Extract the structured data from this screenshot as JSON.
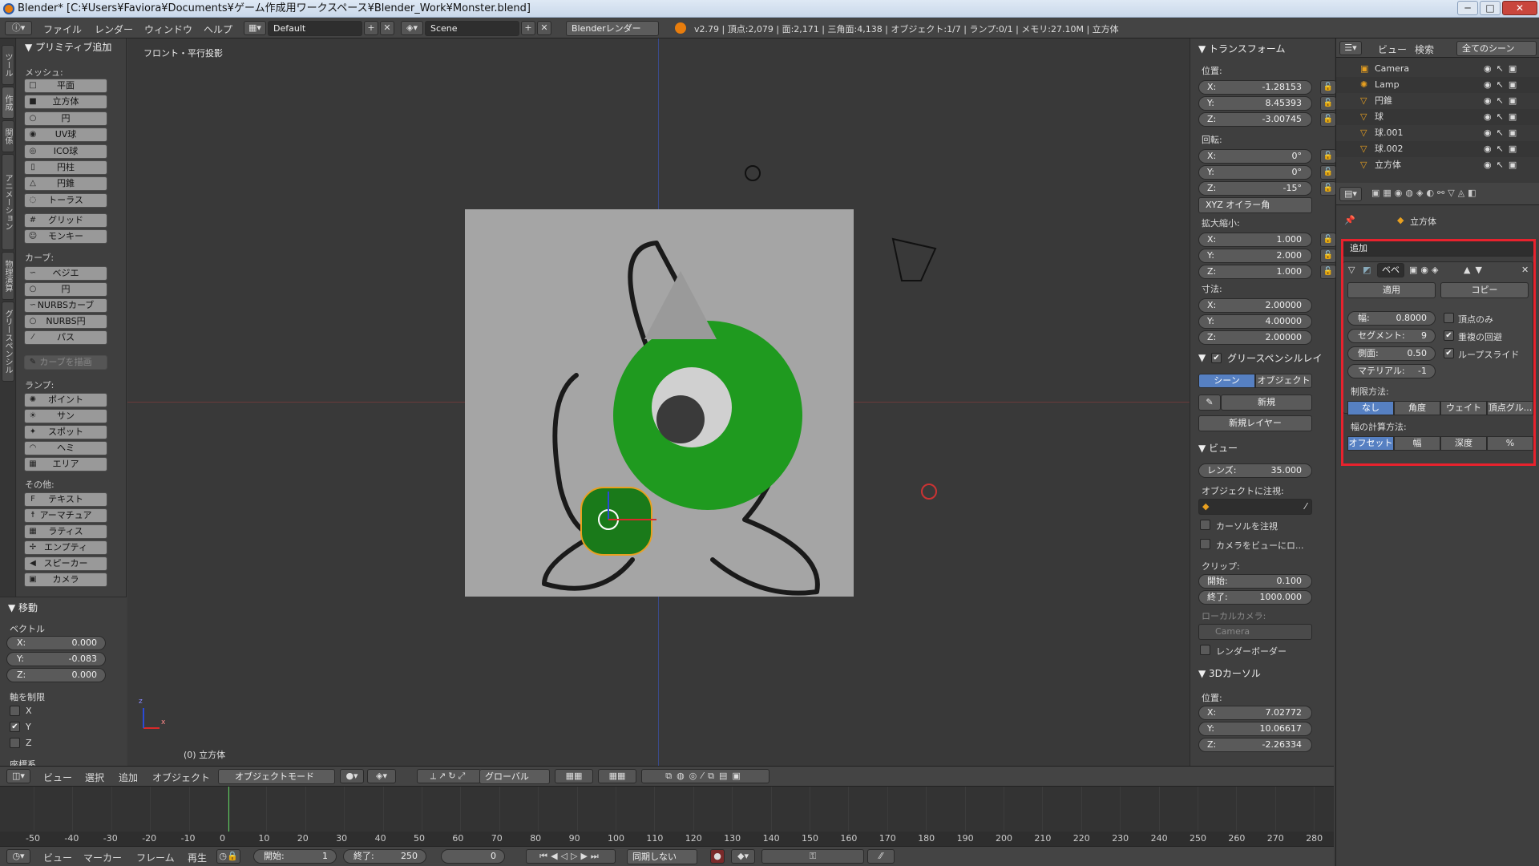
{
  "window": {
    "title": "Blender* [C:¥Users¥Faviora¥Documents¥ゲーム作成用ワークスペース¥Blender_Work¥Monster.blend]",
    "controls": [
      "─",
      "□",
      "✕"
    ]
  },
  "info_header": {
    "menus": [
      "ファイル",
      "レンダー",
      "ウィンドウ",
      "ヘルプ"
    ],
    "layout": "Default",
    "scene": "Scene",
    "engine": "Blenderレンダー",
    "stats": "v2.79 | 頂点:2,079 | 面:2,171 | 三角面:4,138 | オブジェクト:1/7 | ランプ:0/1 | メモリ:27.10M | 立方体"
  },
  "left_tabs": [
    "ツール",
    "作成",
    "関係",
    "アニメーション",
    "物理演算",
    "グリースペンシル"
  ],
  "toolshelf": {
    "header": "▼ プリミティブ追加",
    "mesh_label": "メッシュ:",
    "mesh": [
      {
        "label": "平面",
        "icon": "□"
      },
      {
        "label": "立方体",
        "icon": "■"
      },
      {
        "label": "円",
        "icon": "○"
      },
      {
        "label": "UV球",
        "icon": "◉"
      },
      {
        "label": "ICO球",
        "icon": "◎"
      },
      {
        "label": "円柱",
        "icon": "▯"
      },
      {
        "label": "円錐",
        "icon": "△"
      },
      {
        "label": "トーラス",
        "icon": "◌"
      }
    ],
    "mesh_extra": [
      {
        "label": "グリッド",
        "icon": "#"
      },
      {
        "label": "モンキー",
        "icon": "☺"
      }
    ],
    "curve_label": "カーブ:",
    "curves": [
      {
        "label": "ベジエ",
        "icon": "∽"
      },
      {
        "label": "円",
        "icon": "○"
      },
      {
        "label": "NURBSカーブ",
        "icon": "∽"
      },
      {
        "label": "NURBS円",
        "icon": "○"
      },
      {
        "label": "パス",
        "icon": "⁄"
      }
    ],
    "draw_curve": "カーブを描画",
    "lamp_label": "ランプ:",
    "lamps": [
      {
        "label": "ポイント",
        "icon": "✺"
      },
      {
        "label": "サン",
        "icon": "☀"
      },
      {
        "label": "スポット",
        "icon": "✦"
      },
      {
        "label": "ヘミ",
        "icon": "◠"
      },
      {
        "label": "エリア",
        "icon": "▦"
      }
    ],
    "other_label": "その他:",
    "others": [
      {
        "label": "テキスト",
        "icon": "F"
      },
      {
        "label": "アーマチュア",
        "icon": "☨"
      },
      {
        "label": "ラティス",
        "icon": "▦"
      },
      {
        "label": "エンプティ",
        "icon": "✢"
      },
      {
        "label": "スピーカー",
        "icon": "◀"
      },
      {
        "label": "カメラ",
        "icon": "▣"
      }
    ]
  },
  "operator_panel": {
    "header": "▼ 移動",
    "vector_label": "ベクトル",
    "vector": [
      {
        "axis": "X:",
        "value": "0.000"
      },
      {
        "axis": "Y:",
        "value": "-0.083"
      },
      {
        "axis": "Z:",
        "value": "0.000"
      }
    ],
    "constrain_label": "軸を制限",
    "axes": [
      {
        "label": "X",
        "checked": false
      },
      {
        "label": "Y",
        "checked": true
      },
      {
        "label": "Z",
        "checked": false
      }
    ],
    "coord_label": "座標系"
  },
  "viewport": {
    "view_name": "フロント・平行投影",
    "object_name": "(0) 立方体",
    "axis_z": "z",
    "axis_x": "x"
  },
  "npanel": {
    "transform_header": "▼ トランスフォーム",
    "location_label": "位置:",
    "location": [
      {
        "axis": "X:",
        "value": "-1.28153"
      },
      {
        "axis": "Y:",
        "value": "8.45393"
      },
      {
        "axis": "Z:",
        "value": "-3.00745"
      }
    ],
    "rotation_label": "回転:",
    "rotation": [
      {
        "axis": "X:",
        "value": "0°"
      },
      {
        "axis": "Y:",
        "value": "0°"
      },
      {
        "axis": "Z:",
        "value": "-15°"
      }
    ],
    "rotation_mode": "XYZ オイラー角",
    "scale_label": "拡大縮小:",
    "scale": [
      {
        "axis": "X:",
        "value": "1.000"
      },
      {
        "axis": "Y:",
        "value": "2.000"
      },
      {
        "axis": "Z:",
        "value": "1.000"
      }
    ],
    "dimensions_label": "寸法:",
    "dimensions": [
      {
        "axis": "X:",
        "value": "2.00000"
      },
      {
        "axis": "Y:",
        "value": "4.00000"
      },
      {
        "axis": "Z:",
        "value": "2.00000"
      }
    ],
    "gp_header": "グリースペンシルレイ",
    "gp_tabs": [
      "シーン",
      "オブジェクト"
    ],
    "gp_new": "新規",
    "gp_new_layer": "新規レイヤー",
    "view_header": "▼ ビュー",
    "lens_label": "レンズ:",
    "lens_value": "35.000",
    "lock_object_label": "オブジェクトに注視:",
    "lock_cursor": "カーソルを注視",
    "lock_camera": "カメラをビューにロ...",
    "clip_label": "クリップ:",
    "clip_start_label": "開始:",
    "clip_start": "0.100",
    "clip_end_label": "終了:",
    "clip_end": "1000.000",
    "local_camera_label": "ローカルカメラ:",
    "local_camera": "Camera",
    "render_border": "レンダーボーダー",
    "cursor_header": "▼ 3Dカーソル",
    "cursor_location_label": "位置:",
    "cursor": [
      {
        "axis": "X:",
        "value": "7.02772"
      },
      {
        "axis": "Y:",
        "value": "10.06617"
      },
      {
        "axis": "Z:",
        "value": "-2.26334"
      }
    ]
  },
  "outliner": {
    "menus": [
      "ビュー",
      "検索"
    ],
    "filter": "全てのシーン",
    "items": [
      "Camera",
      "Lamp",
      "円錐",
      "球",
      "球.001",
      "球.002",
      "立方体"
    ]
  },
  "properties": {
    "object_name": "立方体",
    "add_modifier": "追加",
    "modifier_name": "ベベ",
    "apply": "適用",
    "copy": "コピー",
    "width_label": "幅:",
    "width_value": "0.8000",
    "segments_label": "セグメント:",
    "segments_value": "9",
    "profile_label": "側面:",
    "profile_value": "0.50",
    "material_label": "マテリアル:",
    "material_value": "-1",
    "vertex_only": "頂点のみ",
    "clamp_overlap": "重複の回避",
    "loop_slide": "ループスライド",
    "limit_label": "制限方法:",
    "limit_options": [
      "なし",
      "角度",
      "ウェイト",
      "頂点グル..."
    ],
    "width_method_label": "幅の計算方法:",
    "width_methods": [
      "オフセット",
      "幅",
      "深度",
      "%"
    ]
  },
  "view3d_header": {
    "menus": [
      "ビュー",
      "選択",
      "追加",
      "オブジェクト"
    ],
    "mode": "オブジェクトモード",
    "orientation": "グローバル"
  },
  "timeline": {
    "ticks": [
      "-50",
      "-40",
      "-30",
      "-20",
      "-10",
      "0",
      "10",
      "20",
      "30",
      "40",
      "50",
      "60",
      "70",
      "80",
      "90",
      "100",
      "110",
      "120",
      "130",
      "140",
      "150",
      "160",
      "170",
      "180",
      "190",
      "200",
      "210",
      "220",
      "230",
      "240",
      "250",
      "260",
      "270",
      "280"
    ],
    "current_frame": 0,
    "menus": [
      "ビュー",
      "マーカー",
      "フレーム",
      "再生"
    ],
    "start_label": "開始:",
    "start": "1",
    "end_label": "終了:",
    "end": "250",
    "frame": "0",
    "sync": "同期しない"
  },
  "colors": {
    "accent_blue": "#5680c2",
    "highlight_red": "#e8222d",
    "monster_green": "#1f9a1f"
  }
}
